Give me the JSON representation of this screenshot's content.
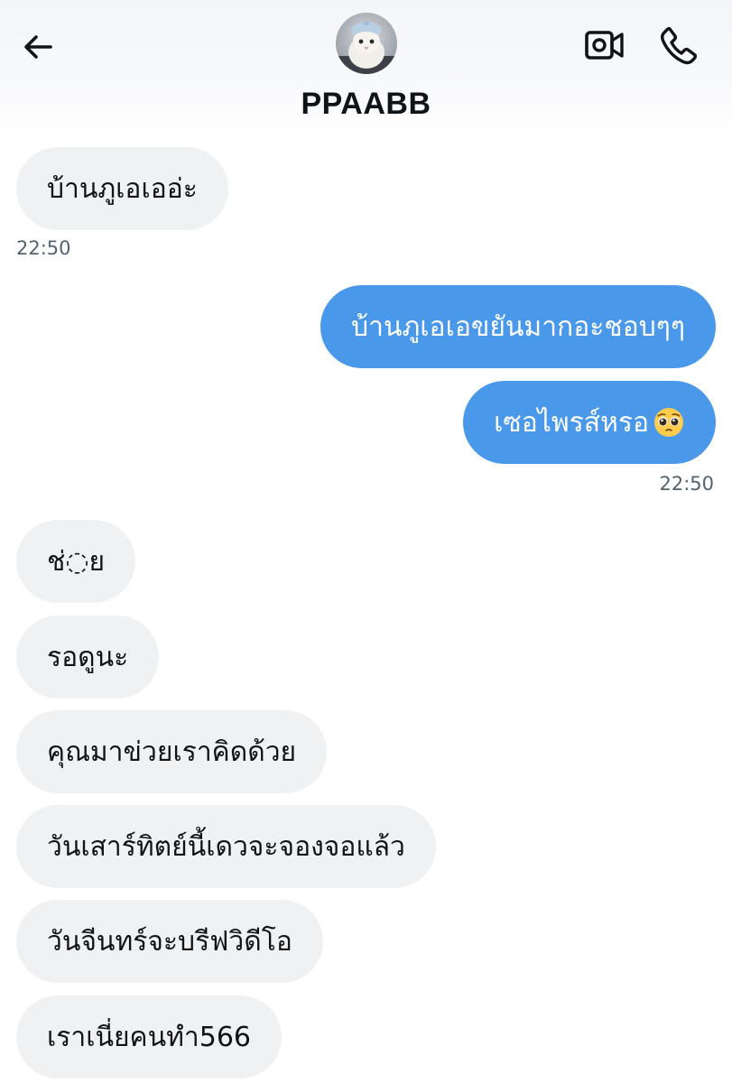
{
  "header": {
    "contact_name": "PPAABB",
    "back_icon": "arrow-left-icon",
    "video_icon": "video-camera-icon",
    "call_icon": "phone-icon"
  },
  "messages": [
    {
      "direction": "in",
      "text": "บ้านภูเอเออ่ะ"
    },
    {
      "direction": "in_time",
      "text": "22:50"
    },
    {
      "direction": "out",
      "text": "บ้านภูเอเอขยันมากอะชอบๆๆ"
    },
    {
      "direction": "out",
      "text": "เซอไพรส์หรอ",
      "emoji": "pleading-face"
    },
    {
      "direction": "out_time",
      "text": "22:50"
    },
    {
      "direction": "in",
      "text": "ช่◌ย"
    },
    {
      "direction": "in",
      "text": "รอดูนะ"
    },
    {
      "direction": "in",
      "text": "คุณมาข่วยเราคิดด้วย"
    },
    {
      "direction": "in",
      "text": "วันเสาร์ทิตย์นี้เดวจะจองจอแล้ว"
    },
    {
      "direction": "in",
      "text": "วันจีนทร์จะบรีฟวิดีโอ"
    },
    {
      "direction": "in",
      "text": "เราเนี่ยคนทำ566"
    }
  ],
  "colors": {
    "outgoing_bubble": "#4a98ea",
    "incoming_bubble": "#eff1f3",
    "timestamp": "#536471",
    "name": "#0f1419"
  }
}
